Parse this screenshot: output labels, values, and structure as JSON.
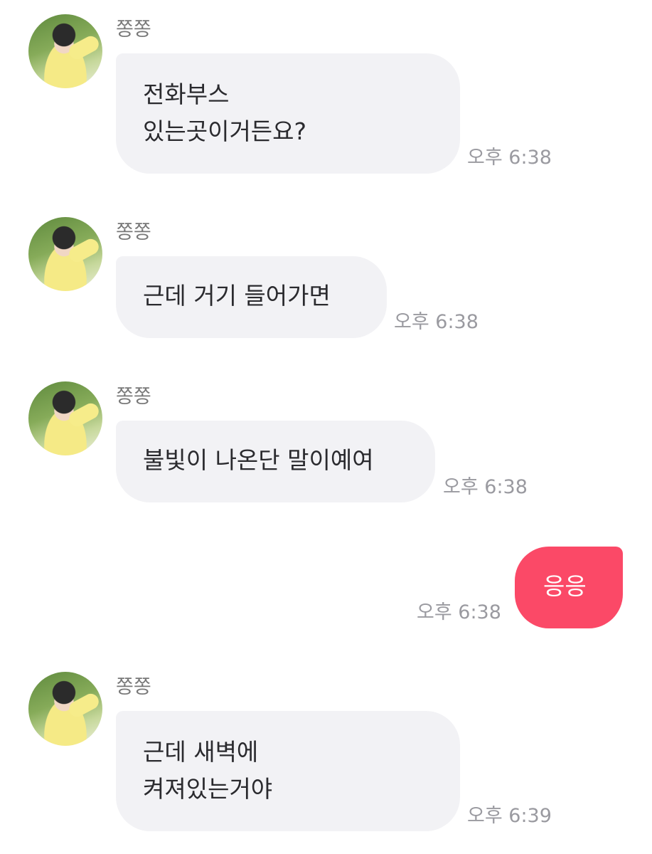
{
  "messages": [
    {
      "sender": "쫑쫑",
      "text": "전화부스\n있는곳이거든요?",
      "time": "오후 6:38"
    },
    {
      "sender": "쫑쫑",
      "text": "근데 거기 들어가면",
      "time": "오후 6:38"
    },
    {
      "sender": "쫑쫑",
      "text": "불빛이 나온단 말이예여",
      "time": "오후 6:38"
    },
    {
      "sender": "me",
      "text": "응응",
      "time": "오후 6:38"
    },
    {
      "sender": "쫑쫑",
      "text": "근데 새벽에\n켜져있는거야",
      "time": "오후 6:39"
    }
  ],
  "colors": {
    "my_bubble": "#fb4967",
    "their_bubble": "#f2f2f5",
    "time_text": "#9a9aa0"
  },
  "icons": {
    "avatar": "profile-photo-avatar"
  }
}
